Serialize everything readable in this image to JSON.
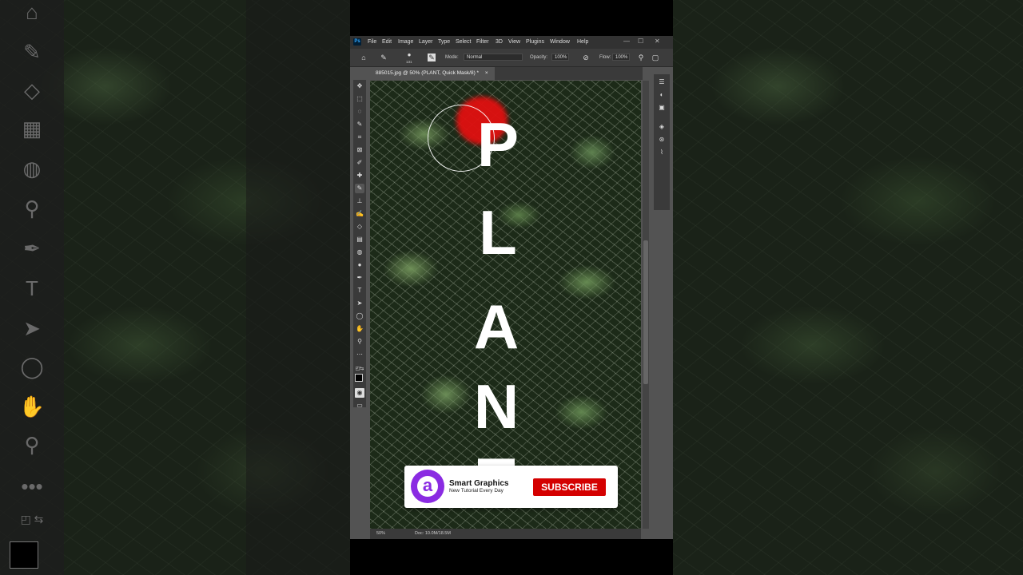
{
  "app": {
    "logo_text": "Ps",
    "menu": [
      "File",
      "Edit",
      "Image",
      "Layer",
      "Type",
      "Select",
      "Filter",
      "3D",
      "View",
      "Plugins",
      "Window",
      "Help"
    ],
    "window_controls": [
      "—",
      "☐",
      "✕"
    ]
  },
  "options_bar": {
    "brush_size": "131",
    "mode_label": "Mode:",
    "mode_value": "Normal",
    "opacity_label": "Opacity:",
    "opacity_value": "100%",
    "flow_label": "Flow:",
    "flow_value": "100%"
  },
  "document": {
    "tab_title": "885015.jpg @ 50% (PLANT, Quick Mask/8) *",
    "tab_close": "×",
    "canvas_text": [
      "P",
      "L",
      "A",
      "N",
      "T"
    ],
    "zoom": "50%",
    "doc_info": "Doc: 10.0M/18.5M",
    "mask_color": "#e01010"
  },
  "subscribe": {
    "logo_letter": "a",
    "channel_name": "Smart Graphics",
    "tagline": "New Tutorial Every Day",
    "button_label": "SUBSCRIBE",
    "button_color": "#d40000"
  },
  "icons": {
    "tools": [
      "move-icon",
      "marquee-icon",
      "lasso-icon",
      "quick-select-icon",
      "crop-icon",
      "frame-icon",
      "eyedropper-icon",
      "healing-icon",
      "brush-icon",
      "stamp-icon",
      "history-brush-icon",
      "eraser-icon",
      "gradient-icon",
      "blur-icon",
      "dodge-icon",
      "pen-icon",
      "type-icon",
      "path-select-icon",
      "shape-icon",
      "hand-icon",
      "zoom-icon",
      "more-icon"
    ],
    "panels": [
      "adjust-icon",
      "color-icon",
      "properties-icon",
      "layers-icon",
      "channels-icon",
      "paths-icon"
    ]
  }
}
